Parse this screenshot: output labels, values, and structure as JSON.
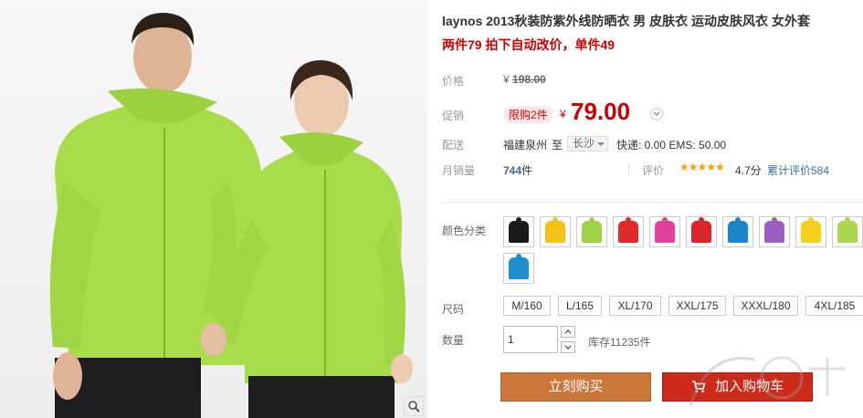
{
  "product": {
    "title": "laynos 2013秋装防紫外线防晒衣 男 皮肤衣 运动皮肤风衣 女外套",
    "promo": "两件79 拍下自动改价，单件49"
  },
  "price": {
    "label": "价格",
    "currency": "¥",
    "original": "198.00"
  },
  "promotion": {
    "label": "促销",
    "badge": "限购2件",
    "currency": "¥",
    "price": "79.00"
  },
  "shipping": {
    "label": "配送",
    "from": "福建泉州",
    "to_word": "至",
    "city": "长沙",
    "fees": "快递: 0.00 EMS: 50.00"
  },
  "sales": {
    "label": "月销量",
    "count": "744",
    "unit": "件",
    "rating_label": "评价",
    "stars": "★★★★★",
    "score": "4.7分",
    "rating_link": "累计评价584"
  },
  "colors": {
    "label": "颜色分类",
    "swatches": [
      {
        "name": "black-jacket",
        "color": "#1a1a1a"
      },
      {
        "name": "yellow-jacket",
        "color": "#f2c21a"
      },
      {
        "name": "lime-jacket",
        "color": "#9fd44a"
      },
      {
        "name": "red-jacket",
        "color": "#e02a2a"
      },
      {
        "name": "pink-jacket",
        "color": "#e0409a"
      },
      {
        "name": "red2-jacket",
        "color": "#d8262c"
      },
      {
        "name": "blue-jacket",
        "color": "#1c86c8"
      },
      {
        "name": "purple-jacket",
        "color": "#9a5ec4"
      },
      {
        "name": "yellow2-jacket",
        "color": "#f5cf1c"
      },
      {
        "name": "green-jacket",
        "color": "#a9d84c"
      },
      {
        "name": "skyblue-jacket",
        "color": "#1e8fd0"
      }
    ]
  },
  "sizes": {
    "label": "尺码",
    "options": [
      "M/160",
      "L/165",
      "XL/170",
      "XXL/175",
      "XXXL/180",
      "4XL/185"
    ]
  },
  "quantity": {
    "label": "数量",
    "value": "1",
    "stock": "库存11235件"
  },
  "actions": {
    "buy_now": "立刻购买",
    "add_cart": "加入购物车"
  },
  "theme": {
    "price_red": "#cc0000",
    "buy_color": "#c9773b",
    "cart_color": "#cc2b1c",
    "link_blue": "#3e6ba0"
  }
}
